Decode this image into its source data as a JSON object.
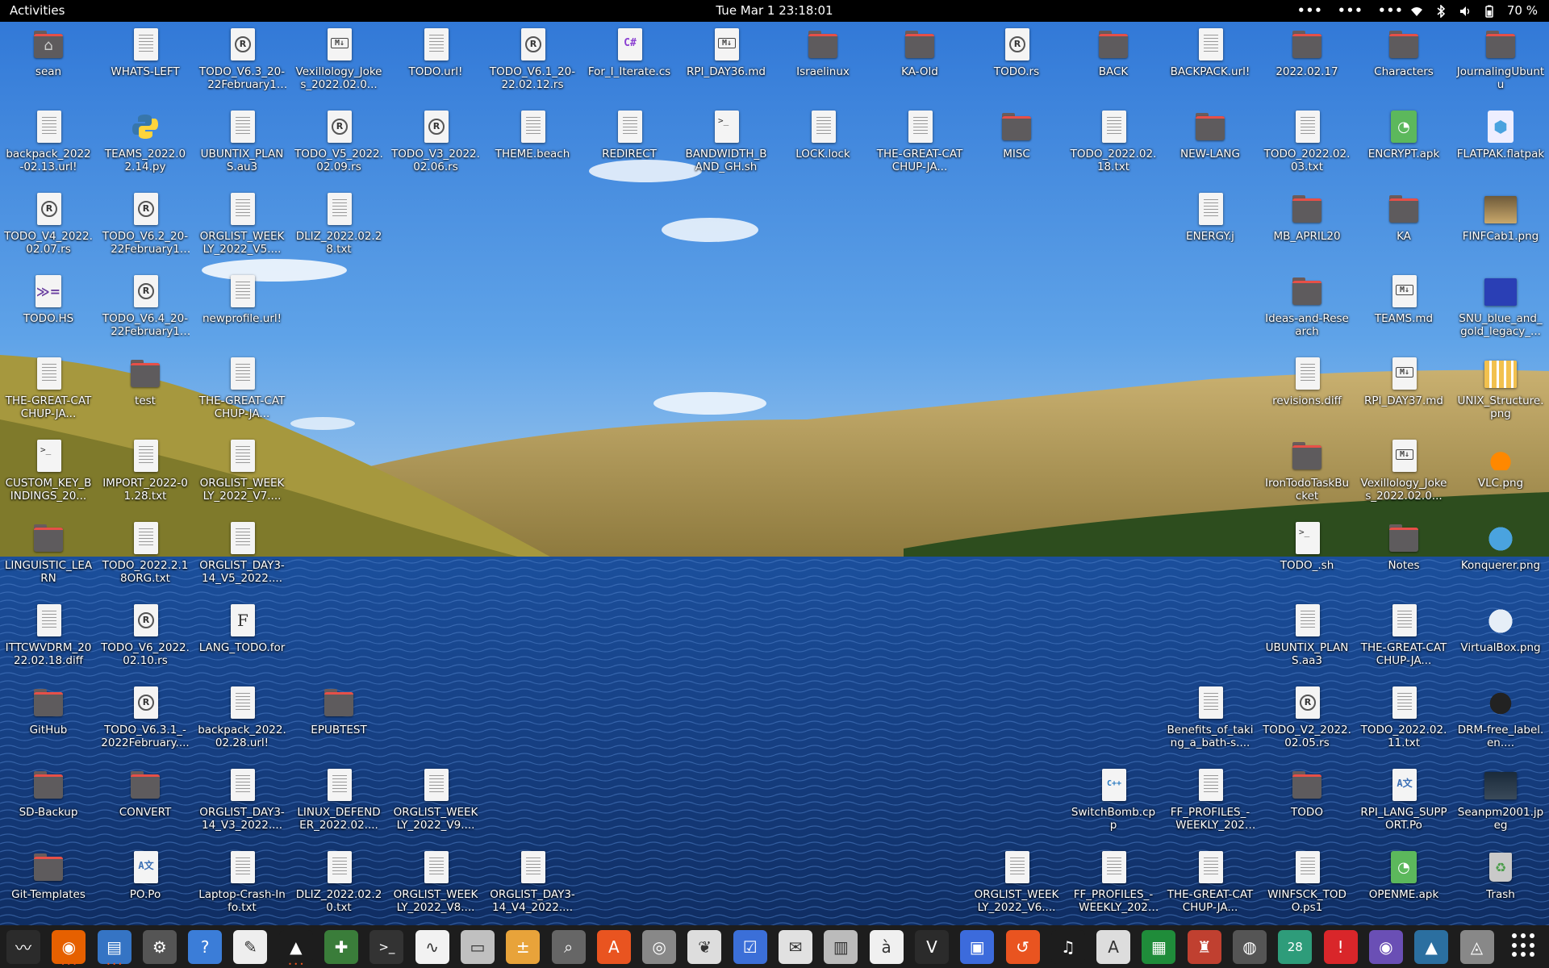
{
  "topbar": {
    "activities": "Activities",
    "clock": "Tue Mar 1  23:18:01",
    "tray_dots": [
      "•••",
      "•••",
      "•••"
    ],
    "battery": "70 %"
  },
  "colors": {
    "folder": "#5e5b5d",
    "folder_accent": "#e65048",
    "dock_bg": "#1d1d1d",
    "topbar_bg": "#000000",
    "dock_indicator": "#e95420"
  },
  "desktop_icons": [
    {
      "label": "sean",
      "type": "home",
      "col": 0,
      "row": 0
    },
    {
      "label": "WHATS-LEFT",
      "type": "doc",
      "col": 1,
      "row": 0
    },
    {
      "label": "TODO_V6.3_20-22February15....",
      "type": "rust",
      "col": 2,
      "row": 0
    },
    {
      "label": "Vexillology_Jokes_2022.02.0...",
      "type": "md",
      "col": 3,
      "row": 0
    },
    {
      "label": "TODO.url!",
      "type": "doc",
      "col": 4,
      "row": 0
    },
    {
      "label": "TODO_V6.1_20-22.02.12.rs",
      "type": "rust",
      "col": 5,
      "row": 0
    },
    {
      "label": "For_I_Iterate.cs",
      "type": "cs",
      "col": 6,
      "row": 0
    },
    {
      "label": "RPI_DAY36.md",
      "type": "md",
      "col": 7,
      "row": 0
    },
    {
      "label": "Israelinux",
      "type": "folder",
      "col": 8,
      "row": 0
    },
    {
      "label": "KA-Old",
      "type": "folder",
      "col": 9,
      "row": 0
    },
    {
      "label": "TODO.rs",
      "type": "rust",
      "col": 10,
      "row": 0
    },
    {
      "label": "BACK",
      "type": "folder",
      "col": 11,
      "row": 0
    },
    {
      "label": "BACKPACK.url!",
      "type": "doc",
      "col": 12,
      "row": 0
    },
    {
      "label": "2022.02.17",
      "type": "folder",
      "col": 13,
      "row": 0
    },
    {
      "label": "Characters",
      "type": "folder",
      "col": 14,
      "row": 0
    },
    {
      "label": "JournalingUbuntu",
      "type": "folder",
      "col": 15,
      "row": 0
    },
    {
      "label": "backpack_2022-02.13.url!",
      "type": "doc",
      "col": 0,
      "row": 1
    },
    {
      "label": "TEAMS_2022.02.14.py",
      "type": "py",
      "col": 1,
      "row": 1
    },
    {
      "label": "UBUNTIX_PLANS.au3",
      "type": "doc",
      "col": 2,
      "row": 1
    },
    {
      "label": "TODO_V5_2022.02.09.rs",
      "type": "rust",
      "col": 3,
      "row": 1
    },
    {
      "label": "TODO_V3_2022.02.06.rs",
      "type": "rust",
      "col": 4,
      "row": 1
    },
    {
      "label": "THEME.beach",
      "type": "doc",
      "col": 5,
      "row": 1
    },
    {
      "label": "REDIRECT",
      "type": "doc",
      "col": 6,
      "row": 1
    },
    {
      "label": "BANDWIDTH_BAND_GH.sh",
      "type": "term",
      "col": 7,
      "row": 1
    },
    {
      "label": "LOCK.lock",
      "type": "doc",
      "col": 8,
      "row": 1
    },
    {
      "label": "THE-GREAT-CATCHUP-JA...",
      "type": "doc",
      "col": 9,
      "row": 1
    },
    {
      "label": "MISC",
      "type": "folder",
      "col": 10,
      "row": 1
    },
    {
      "label": "TODO_2022.02.18.txt",
      "type": "doc",
      "col": 11,
      "row": 1
    },
    {
      "label": "NEW-LANG",
      "type": "folder",
      "col": 12,
      "row": 1
    },
    {
      "label": "TODO_2022.02.03.txt",
      "type": "doc",
      "col": 13,
      "row": 1
    },
    {
      "label": "ENCRYPT.apk",
      "type": "apk",
      "col": 14,
      "row": 1
    },
    {
      "label": "FLATPAK.flatpak",
      "type": "flatpak",
      "col": 15,
      "row": 1
    },
    {
      "label": "TODO_V4_2022.02.07.rs",
      "type": "rust",
      "col": 0,
      "row": 2
    },
    {
      "label": "TODO_V6.2_20-22February14....",
      "type": "rust",
      "col": 1,
      "row": 2
    },
    {
      "label": "ORGLIST_WEEKLY_2022_V5....",
      "type": "doc",
      "col": 2,
      "row": 2
    },
    {
      "label": "DLIZ_2022.02.28.txt",
      "type": "doc",
      "col": 3,
      "row": 2
    },
    {
      "label": "ENERGY.j",
      "type": "doc",
      "col": 12,
      "row": 2
    },
    {
      "label": "MB_APRIL20",
      "type": "folder",
      "col": 13,
      "row": 2
    },
    {
      "label": "KA",
      "type": "folder",
      "col": 14,
      "row": 2
    },
    {
      "label": "FINFCab1.png",
      "type": "img-cab",
      "col": 15,
      "row": 2
    },
    {
      "label": "TODO.HS",
      "type": "hs",
      "col": 0,
      "row": 3
    },
    {
      "label": "TODO_V6.4_20-22February16....",
      "type": "rust",
      "col": 1,
      "row": 3
    },
    {
      "label": "newprofile.url!",
      "type": "doc",
      "col": 2,
      "row": 3
    },
    {
      "label": "Ideas-and-Research",
      "type": "folder",
      "col": 13,
      "row": 3
    },
    {
      "label": "TEAMS.md",
      "type": "md",
      "col": 14,
      "row": 3
    },
    {
      "label": "SNU_blue_and_gold_legacy_...",
      "type": "img-snu",
      "col": 15,
      "row": 3
    },
    {
      "label": "THE-GREAT-CATCHUP-JA...",
      "type": "doc",
      "col": 0,
      "row": 4
    },
    {
      "label": "test",
      "type": "folder",
      "col": 1,
      "row": 4
    },
    {
      "label": "THE-GREAT-CATCHUP-JA...",
      "type": "doc",
      "col": 2,
      "row": 4
    },
    {
      "label": "revisions.diff",
      "type": "doc",
      "col": 13,
      "row": 4
    },
    {
      "label": "RPI_DAY37.md",
      "type": "md",
      "col": 14,
      "row": 4
    },
    {
      "label": "UNIX_Structure.png",
      "type": "img-unix",
      "col": 15,
      "row": 4
    },
    {
      "label": "CUSTOM_KEY_BINDINGS_20...",
      "type": "term",
      "col": 0,
      "row": 5
    },
    {
      "label": "IMPORT_2022-01.28.txt",
      "type": "doc",
      "col": 1,
      "row": 5
    },
    {
      "label": "ORGLIST_WEEKLY_2022_V7....",
      "type": "doc",
      "col": 2,
      "row": 5
    },
    {
      "label": "IronTodoTaskBucket",
      "type": "folder",
      "col": 13,
      "row": 5
    },
    {
      "label": "Vexillology_Jokes_2022.02.0...",
      "type": "md",
      "col": 14,
      "row": 5
    },
    {
      "label": "VLC.png",
      "type": "img-vlc",
      "col": 15,
      "row": 5
    },
    {
      "label": "LINGUISTIC_LEARN",
      "type": "folder",
      "col": 0,
      "row": 6
    },
    {
      "label": "TODO_2022.2.18ORG.txt",
      "type": "doc",
      "col": 1,
      "row": 6
    },
    {
      "label": "ORGLIST_DAY3-14_V5_2022....",
      "type": "doc",
      "col": 2,
      "row": 6
    },
    {
      "label": "TODO_.sh",
      "type": "term",
      "col": 13,
      "row": 6
    },
    {
      "label": "Notes",
      "type": "folder",
      "col": 14,
      "row": 6
    },
    {
      "label": "Konquerer.png",
      "type": "img-konq",
      "col": 15,
      "row": 6
    },
    {
      "label": "ITTCWVDRM_2022.02.18.diff",
      "type": "doc",
      "col": 0,
      "row": 7
    },
    {
      "label": "TODO_V6_2022.02.10.rs",
      "type": "rust",
      "col": 1,
      "row": 7
    },
    {
      "label": "LANG_TODO.for",
      "type": "fnt",
      "col": 2,
      "row": 7
    },
    {
      "label": "UBUNTIX_PLANS.aa3",
      "type": "doc",
      "col": 13,
      "row": 7
    },
    {
      "label": "THE-GREAT-CATCHUP-JA...",
      "type": "doc",
      "col": 14,
      "row": 7
    },
    {
      "label": "VirtualBox.png",
      "type": "img-vbox",
      "col": 15,
      "row": 7
    },
    {
      "label": "GitHub",
      "type": "folder",
      "col": 0,
      "row": 8
    },
    {
      "label": "TODO_V6.3.1_-2022February....",
      "type": "rust",
      "col": 1,
      "row": 8
    },
    {
      "label": "backpack_2022.02.28.url!",
      "type": "doc",
      "col": 2,
      "row": 8
    },
    {
      "label": "EPUBTEST",
      "type": "folder",
      "col": 3,
      "row": 8
    },
    {
      "label": "Benefits_of_taking_a_bath-s....",
      "type": "doc",
      "col": 12,
      "row": 8
    },
    {
      "label": "TODO_V2_2022.02.05.rs",
      "type": "rust",
      "col": 13,
      "row": 8
    },
    {
      "label": "TODO_2022.02.11.txt",
      "type": "doc",
      "col": 14,
      "row": 8
    },
    {
      "label": "DRM-free_label.en....",
      "type": "img-drm",
      "col": 15,
      "row": 8
    },
    {
      "label": "SD-Backup",
      "type": "folder",
      "col": 0,
      "row": 9
    },
    {
      "label": "CONVERT",
      "type": "folder",
      "col": 1,
      "row": 9
    },
    {
      "label": "ORGLIST_DAY3-14_V3_2022....",
      "type": "doc",
      "col": 2,
      "row": 9
    },
    {
      "label": "LINUX_DEFENDER_2022.02....",
      "type": "doc",
      "col": 3,
      "row": 9
    },
    {
      "label": "ORGLIST_WEEKLY_2022_V9....",
      "type": "doc",
      "col": 4,
      "row": 9
    },
    {
      "label": "SwitchBomb.cpp",
      "type": "cpp",
      "col": 11,
      "row": 9
    },
    {
      "label": "FF_PROFILES_-WEEKLY_2022....",
      "type": "doc",
      "col": 12,
      "row": 9
    },
    {
      "label": "TODO",
      "type": "folder",
      "col": 13,
      "row": 9
    },
    {
      "label": "RPI_LANG_SUPPORT.Po",
      "type": "po",
      "col": 14,
      "row": 9
    },
    {
      "label": "Seanpm2001.jpeg",
      "type": "img-photo",
      "col": 15,
      "row": 9
    },
    {
      "label": "Git-Templates",
      "type": "folder",
      "col": 0,
      "row": 10
    },
    {
      "label": "PO.Po",
      "type": "po",
      "col": 1,
      "row": 10
    },
    {
      "label": "Laptop-Crash-Info.txt",
      "type": "doc",
      "col": 2,
      "row": 10
    },
    {
      "label": "DLIZ_2022.02.20.txt",
      "type": "doc",
      "col": 3,
      "row": 10
    },
    {
      "label": "ORGLIST_WEEKLY_2022_V8....",
      "type": "doc",
      "col": 4,
      "row": 10
    },
    {
      "label": "ORGLIST_DAY3-14_V4_2022....",
      "type": "doc",
      "col": 5,
      "row": 10
    },
    {
      "label": "ORGLIST_WEEKLY_2022_V6....",
      "type": "doc",
      "col": 10,
      "row": 10
    },
    {
      "label": "FF_PROFILES_-WEEKLY_2022....",
      "type": "doc",
      "col": 11,
      "row": 10
    },
    {
      "label": "THE-GREAT-CATCHUP-JA...",
      "type": "doc",
      "col": 12,
      "row": 10
    },
    {
      "label": "WINFSCK_TODO.ps1",
      "type": "doc",
      "col": 13,
      "row": 10
    },
    {
      "label": "OPENME.apk",
      "type": "apk",
      "col": 14,
      "row": 10
    },
    {
      "label": "Trash",
      "type": "trash",
      "col": 15,
      "row": 10
    }
  ],
  "dock": [
    {
      "name": "system-monitor",
      "glyph": "〰",
      "bg": "#2b2b2b"
    },
    {
      "name": "firefox",
      "glyph": "◉",
      "bg": "#e66000"
    },
    {
      "name": "text-editor-dots",
      "glyph": "▤",
      "bg": "#3574c4"
    },
    {
      "name": "settings",
      "glyph": "⚙",
      "bg": "#555"
    },
    {
      "name": "help",
      "glyph": "?",
      "bg": "#3b7dd8"
    },
    {
      "name": "gedit",
      "glyph": "✎",
      "bg": "#eeeeee"
    },
    {
      "name": "vlc",
      "glyph": "▲",
      "bg": "#1d1d1d"
    },
    {
      "name": "puzzle",
      "glyph": "✚",
      "bg": "#3a7d3a"
    },
    {
      "name": "terminal",
      "glyph": ">_",
      "bg": "#333"
    },
    {
      "name": "graph",
      "glyph": "∿",
      "bg": "#f2f2f2"
    },
    {
      "name": "files",
      "glyph": "▭",
      "bg": "#c0c0c0"
    },
    {
      "name": "calculator",
      "glyph": "±",
      "bg": "#e8a33a"
    },
    {
      "name": "image-viewer",
      "glyph": "⌕",
      "bg": "#666"
    },
    {
      "name": "app-store",
      "glyph": "A",
      "bg": "#e95420"
    },
    {
      "name": "disc",
      "glyph": "◎",
      "bg": "#888"
    },
    {
      "name": "dictionary",
      "glyph": "❦",
      "bg": "#ddd"
    },
    {
      "name": "tasks",
      "glyph": "☑",
      "bg": "#3b6fd8"
    },
    {
      "name": "mail",
      "glyph": "✉",
      "bg": "#e1e1e1"
    },
    {
      "name": "archive",
      "glyph": "▥",
      "bg": "#bbb"
    },
    {
      "name": "character-map",
      "glyph": "à",
      "bg": "#f0f0f0"
    },
    {
      "name": "vim",
      "glyph": "V",
      "bg": "#2b2b2b"
    },
    {
      "name": "screens",
      "glyph": "▣",
      "bg": "#3c6bdc"
    },
    {
      "name": "backup",
      "glyph": "↺",
      "bg": "#e95420"
    },
    {
      "name": "music",
      "glyph": "♫",
      "bg": "#1d1d1d"
    },
    {
      "name": "pdf-reader",
      "glyph": "A",
      "bg": "#dddddd"
    },
    {
      "name": "spreadsheet",
      "glyph": "▦",
      "bg": "#1f8c3a"
    },
    {
      "name": "game",
      "glyph": "♜",
      "bg": "#c04030"
    },
    {
      "name": "dvd",
      "glyph": "◍",
      "bg": "#555"
    },
    {
      "name": "calendar",
      "glyph": "28",
      "bg": "#2e9c7a"
    },
    {
      "name": "alert",
      "glyph": "!",
      "bg": "#d9262a"
    },
    {
      "name": "camera",
      "glyph": "◉",
      "bg": "#6a4fb5"
    },
    {
      "name": "image-editor",
      "glyph": "▲",
      "bg": "#2b6fa0"
    },
    {
      "name": "installer",
      "glyph": "◬",
      "bg": "#888"
    }
  ]
}
